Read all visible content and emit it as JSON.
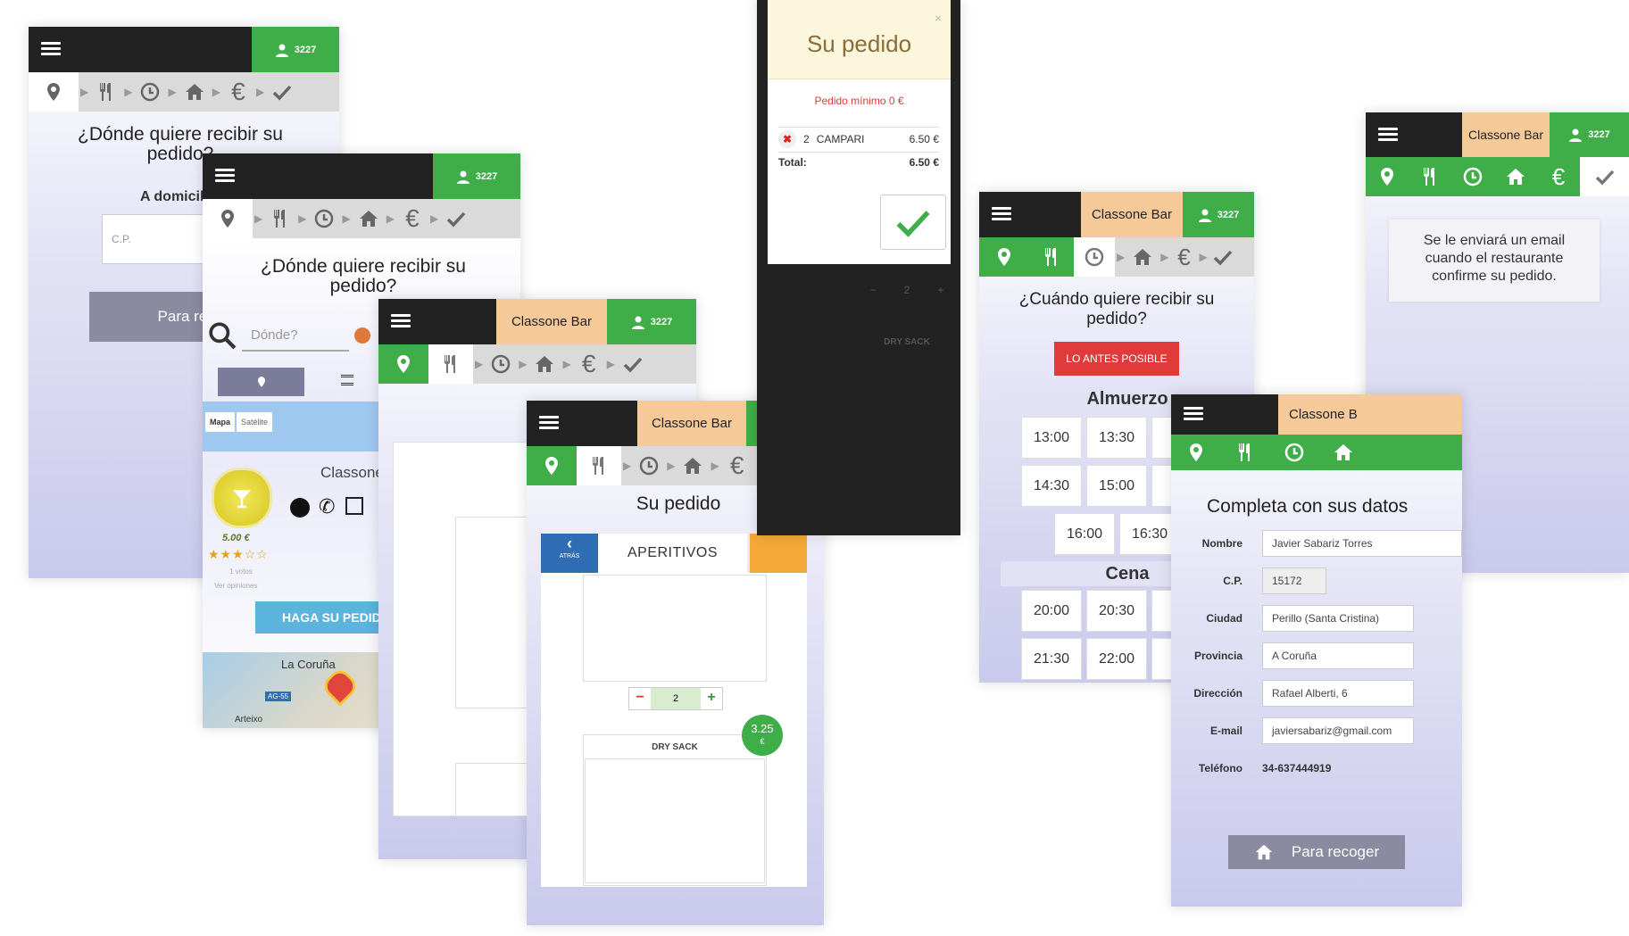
{
  "common": {
    "user_badge": "3227",
    "restaurant_name": "Classone Bar",
    "restaurant_short_1": "Classone B",
    "restaurant_short_2": "Classo"
  },
  "screen1": {
    "question": "¿Dónde quiere recibir su pedido?",
    "delivery_label": "A domicilio",
    "cp_placeholder": "C.P.",
    "button": "Para recibir"
  },
  "screen2": {
    "question": "¿Dónde quiere recibir su pedido?",
    "search_placeholder": "Dónde?",
    "map_tab": "Mapa",
    "satellite_tab": "Satélite",
    "restaurant_name": "Classone Bar",
    "price": "5.00 €",
    "rating": 3,
    "votes": "1 votos",
    "opinions": "Ver opiniones",
    "order_button": "HAGA SU PEDIDO",
    "map_city": "La Coruña",
    "map_road": "AG-55",
    "map_town": "Arteixo"
  },
  "screen3": {
    "title": "Su pedido"
  },
  "screen4": {
    "title": "Su pedido",
    "back_label": "ATRÁS",
    "category": "APERITIVOS",
    "qty": "2",
    "item_name": "DRY SACK",
    "item_price": "3.25",
    "item_currency": "€"
  },
  "modal": {
    "title": "Su pedido",
    "minimum": "Pedido mínimo 0 €",
    "line_qty": "2",
    "line_name": "CAMPARI",
    "line_price": "6.50 €",
    "total_label": "Total:",
    "total_value": "6.50 €",
    "bg_qty": "2",
    "bg_item": "DRY SACK"
  },
  "screen5": {
    "question": "¿Cuándo quiere recibir su pedido?",
    "asap": "LO ANTES POSIBLE",
    "lunch_label": "Almuerzo",
    "lunch_slots": [
      "13:00",
      "13:30",
      "14:30",
      "15:00",
      "16:00",
      "16:30"
    ],
    "dinner_label": "Cena",
    "dinner_slots": [
      "20:00",
      "20:30",
      "21:30",
      "22:00"
    ]
  },
  "screen6": {
    "title": "Completa con sus datos",
    "fields": [
      {
        "label": "Nombre",
        "value": "Javier Sabariz Torres"
      },
      {
        "label": "C.P.",
        "value": "15172"
      },
      {
        "label": "Ciudad",
        "value": "Perillo (Santa Cristina)"
      },
      {
        "label": "Provincia",
        "value": "A Coruña"
      },
      {
        "label": "Dirección",
        "value": "Rafael Alberti, 6"
      },
      {
        "label": "E-mail",
        "value": "javiersabariz@gmail.com"
      },
      {
        "label": "Teléfono",
        "value": "34-637444919"
      }
    ],
    "button": "Para recoger"
  },
  "screen7": {
    "message": "Se le enviará un email cuando el restaurante confirme su pedido."
  },
  "colors": {
    "green": "#3fae49",
    "dark": "#222222",
    "peach": "#f5c998",
    "red": "#e03a3a",
    "blue": "#2f6db5"
  }
}
